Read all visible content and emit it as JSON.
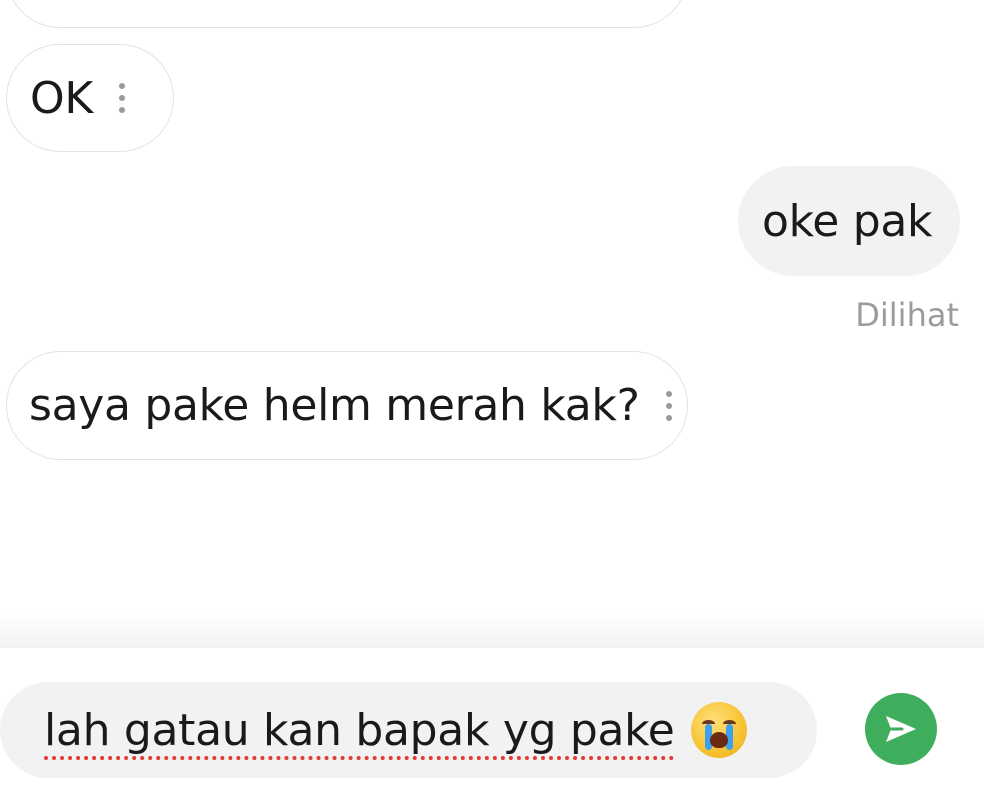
{
  "messages": [
    {
      "direction": "incoming",
      "text": ""
    },
    {
      "direction": "incoming",
      "text": "OK"
    },
    {
      "direction": "outgoing",
      "text": "oke pak"
    },
    {
      "direction": "incoming",
      "text": "saya pake helm merah kak?"
    }
  ],
  "seen_status": "Dilihat",
  "composer": {
    "value": "lah gatau kan bapak yg pake",
    "emoji": "loudly-crying-face"
  },
  "colors": {
    "send_button": "#3fae5c",
    "incoming_border": "#e2e2e2",
    "outgoing_bg": "#f2f2f2",
    "spellcheck": "#e53935"
  }
}
